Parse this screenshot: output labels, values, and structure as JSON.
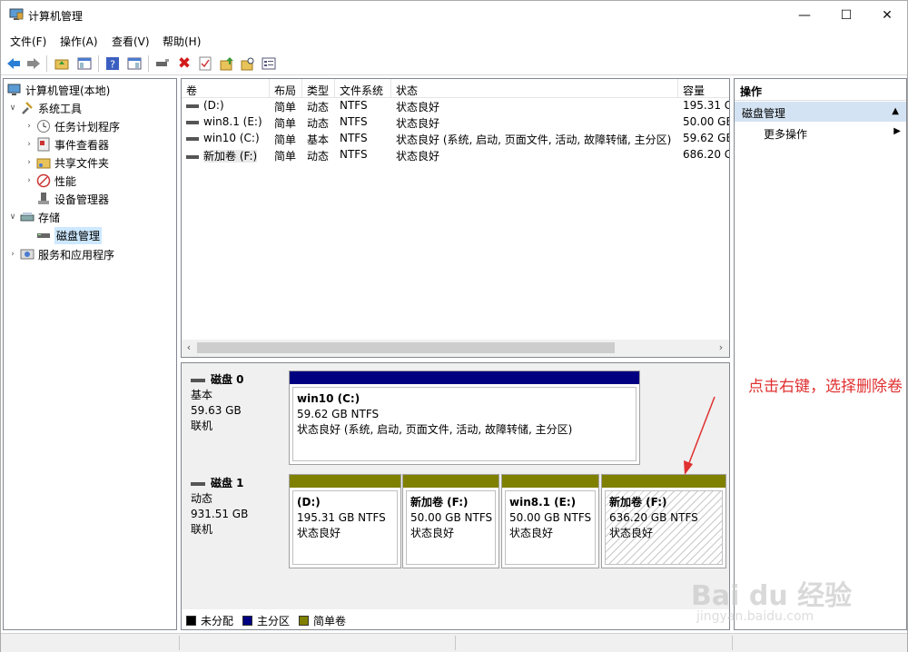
{
  "window": {
    "title": "计算机管理"
  },
  "menu": [
    "文件(F)",
    "操作(A)",
    "查看(V)",
    "帮助(H)"
  ],
  "tree": {
    "root": "计算机管理(本地)",
    "system_tools": "系统工具",
    "task_scheduler": "任务计划程序",
    "event_viewer": "事件查看器",
    "shared_folders": "共享文件夹",
    "performance": "性能",
    "device_manager": "设备管理器",
    "storage": "存储",
    "disk_management": "磁盘管理",
    "services_apps": "服务和应用程序"
  },
  "list": {
    "headers": [
      "卷",
      "布局",
      "类型",
      "文件系统",
      "状态",
      "容量"
    ],
    "rows": [
      [
        "(D:)",
        "简单",
        "动态",
        "NTFS",
        "状态良好",
        "195.31 G"
      ],
      [
        "win8.1 (E:)",
        "简单",
        "动态",
        "NTFS",
        "状态良好",
        "50.00 GB"
      ],
      [
        "win10 (C:)",
        "简单",
        "基本",
        "NTFS",
        "状态良好 (系统, 启动, 页面文件, 活动, 故障转储, 主分区)",
        "59.62 GB"
      ],
      [
        "新加卷 (F:)",
        "简单",
        "动态",
        "NTFS",
        "状态良好",
        "686.20 G"
      ]
    ]
  },
  "disks": [
    {
      "name": "磁盘 0",
      "kind": "基本",
      "size": "59.63 GB",
      "state": "联机",
      "partitions": [
        {
          "name": "win10  (C:)",
          "size": "59.62 GB NTFS",
          "status": "状态良好 (系统, 启动, 页面文件, 活动, 故障转储, 主分区)"
        }
      ]
    },
    {
      "name": "磁盘 1",
      "kind": "动态",
      "size": "931.51 GB",
      "state": "联机",
      "partitions": [
        {
          "name": "(D:)",
          "size": "195.31 GB NTFS",
          "status": "状态良好"
        },
        {
          "name": "新加卷  (F:)",
          "size": "50.00 GB NTFS",
          "status": "状态良好"
        },
        {
          "name": "win8.1  (E:)",
          "size": "50.00 GB NTFS",
          "status": "状态良好"
        },
        {
          "name": "新加卷  (F:)",
          "size": "636.20 GB NTFS",
          "status": "状态良好"
        }
      ]
    }
  ],
  "legend": [
    "未分配",
    "主分区",
    "简单卷"
  ],
  "colors": {
    "unallocated": "#000000",
    "primary": "#000080",
    "simple": "#808000",
    "annotation": "#e03030"
  },
  "actions": {
    "title": "操作",
    "section": "磁盘管理",
    "more": "更多操作"
  },
  "annotation": "点击右键，选择删除卷",
  "watermark": {
    "main": "Bai du 经验",
    "sub": "jingyan.baidu.com"
  }
}
